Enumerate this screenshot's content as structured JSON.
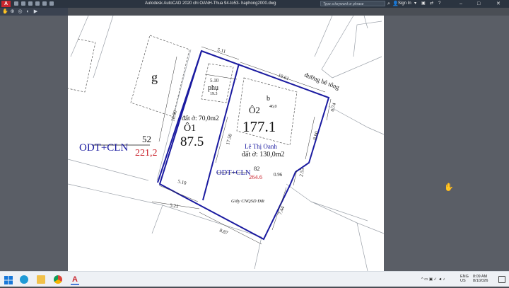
{
  "window": {
    "title": "Autodesk AutoCAD 2020    chi OANH-Thua 94-to53- haphong2000.dwg",
    "search_placeholder": "Type a keyword or phrase",
    "sign_in": "Sign In"
  },
  "drawing": {
    "lot_g": "g",
    "lot1_label": "Ô1",
    "lot1_area": "87.5",
    "lot1_note": "đất ở: 70,0m2",
    "lot2_label": "Ô2",
    "lot2_area": "177.1",
    "lot2_b": "b",
    "lot2_b_val": "46,0",
    "phu_label": "phụ",
    "phu_val": "19.3",
    "road_label": "đường bê tông",
    "owner": "Lê Thị Oanh",
    "owner_note": "đất ở: 130,0m2",
    "cert_note": "Giấy CNQSD Đất",
    "land_left_code": "ODT+CLN",
    "land_left_num": "52",
    "land_left_area": "221,2",
    "land_mid_code": "ODT+CLN",
    "land_mid_num": "82",
    "land_mid_area": "264.6",
    "dims": {
      "d511": "5.11",
      "d510a": "5.10",
      "d1061": "10.61",
      "d1880": "18.80",
      "d1750": "17.50",
      "d074": "0.74",
      "d800": "8.00",
      "d510b": "5.10",
      "d521": "5.21",
      "d887": "8.87",
      "d744": "7.44",
      "d255": "2.55",
      "d096": "0.96"
    }
  },
  "taskbar": {
    "lang1": "ENG",
    "lang2": "US",
    "time": "8:09 AM",
    "date": "8/1/2026"
  },
  "colors": {
    "boundary": "#1a1aa0",
    "red_text": "#c81e28",
    "blue_text": "#1a1aa0",
    "titlebar": "#2b3440"
  }
}
